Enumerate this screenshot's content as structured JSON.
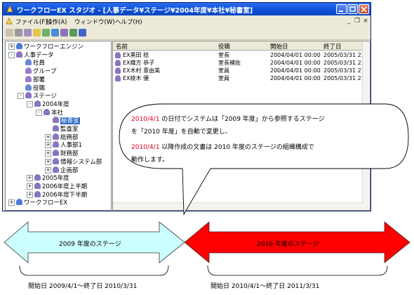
{
  "window": {
    "title": "ワークフローEX スタジオ - [人事データ¥ステージ¥2004年度¥本社¥秘書室]"
  },
  "menu": [
    "ファイル(F)",
    "操作(A)",
    "ウィンドウ(W)",
    "ヘルプ(H)"
  ],
  "toolbar_icons": [
    "back-icon",
    "forward-icon",
    "user-icon",
    "group-icon",
    "org-icon",
    "role-icon",
    "stage-icon",
    "prop-icon",
    "refresh-icon"
  ],
  "tree": [
    {
      "label": "ワークフローエンジン",
      "level": 0,
      "exp": "+",
      "icon": "engine"
    },
    {
      "label": "人事データ",
      "level": 0,
      "exp": "-",
      "icon": "people"
    },
    {
      "label": "社員",
      "level": 1,
      "exp": "",
      "icon": "person"
    },
    {
      "label": "グループ",
      "level": 1,
      "exp": "",
      "icon": "group"
    },
    {
      "label": "部署",
      "level": 1,
      "exp": "",
      "icon": "group"
    },
    {
      "label": "役職",
      "level": 1,
      "exp": "",
      "icon": "person"
    },
    {
      "label": "ステージ",
      "level": 1,
      "exp": "-",
      "icon": "people"
    },
    {
      "label": "2004年度",
      "level": 2,
      "exp": "-",
      "icon": "people"
    },
    {
      "label": "本社",
      "level": 3,
      "exp": "-",
      "icon": "people"
    },
    {
      "label": "秘書室",
      "level": 4,
      "exp": "",
      "icon": "people",
      "selected": true
    },
    {
      "label": "監査室",
      "level": 4,
      "exp": "",
      "icon": "people"
    },
    {
      "label": "総務部",
      "level": 4,
      "exp": "+",
      "icon": "people"
    },
    {
      "label": "人事部1",
      "level": 4,
      "exp": "+",
      "icon": "people"
    },
    {
      "label": "財務部",
      "level": 4,
      "exp": "+",
      "icon": "people"
    },
    {
      "label": "情報システム部",
      "level": 4,
      "exp": "+",
      "icon": "people"
    },
    {
      "label": "企画部",
      "level": 4,
      "exp": "+",
      "icon": "people"
    },
    {
      "label": "2005年度",
      "level": 2,
      "exp": "+",
      "icon": "people"
    },
    {
      "label": "2006年度上半期",
      "level": 2,
      "exp": "+",
      "icon": "people"
    },
    {
      "label": "2006年度下半期",
      "level": 2,
      "exp": "+",
      "icon": "people"
    },
    {
      "label": "ワークフローEX",
      "level": 0,
      "exp": "+",
      "icon": "engine"
    }
  ],
  "list": {
    "columns": [
      "名前",
      "役職",
      "開始日",
      "終了日"
    ],
    "rows": [
      {
        "name": "EX黒田 稔",
        "role": "室長",
        "start": "2004/04/01 00:00",
        "end": "2005/03/31 23:59"
      },
      {
        "name": "EX織方 恭子",
        "role": "室長補佐",
        "start": "2004/04/01 00:00",
        "end": "2005/03/31 23:59"
      },
      {
        "name": "EX木村 亜由美",
        "role": "室員",
        "start": "2004/04/01 00:00",
        "end": "2005/03/31 23:59"
      },
      {
        "name": "EX綾木 優",
        "role": "室員",
        "start": "2004/04/01 00:00",
        "end": "2005/03/31 23:59"
      }
    ]
  },
  "callout": {
    "line1_red": "2010/4/1",
    "line1_rest": " の日付でシステムは「2009 年度」から参照するステージ",
    "line2": "を「2010 年度」を自動で変更し、",
    "line3_red": "2010/4/1",
    "line3_rest": " 以降作成の文書は 2010 年度のステージの組織構成で",
    "line4": "動作します。"
  },
  "arrows": {
    "left_label": "2009 年度のステージ",
    "right_label": "2010 年度のステージ",
    "left_color": "#ccffff",
    "right_color": "#ff0000"
  },
  "ranges": {
    "left": "開始日 2009/4/1～終了日 2010/3/31",
    "right": "開始日 2010/4/1～終了日 2011/3/31"
  }
}
